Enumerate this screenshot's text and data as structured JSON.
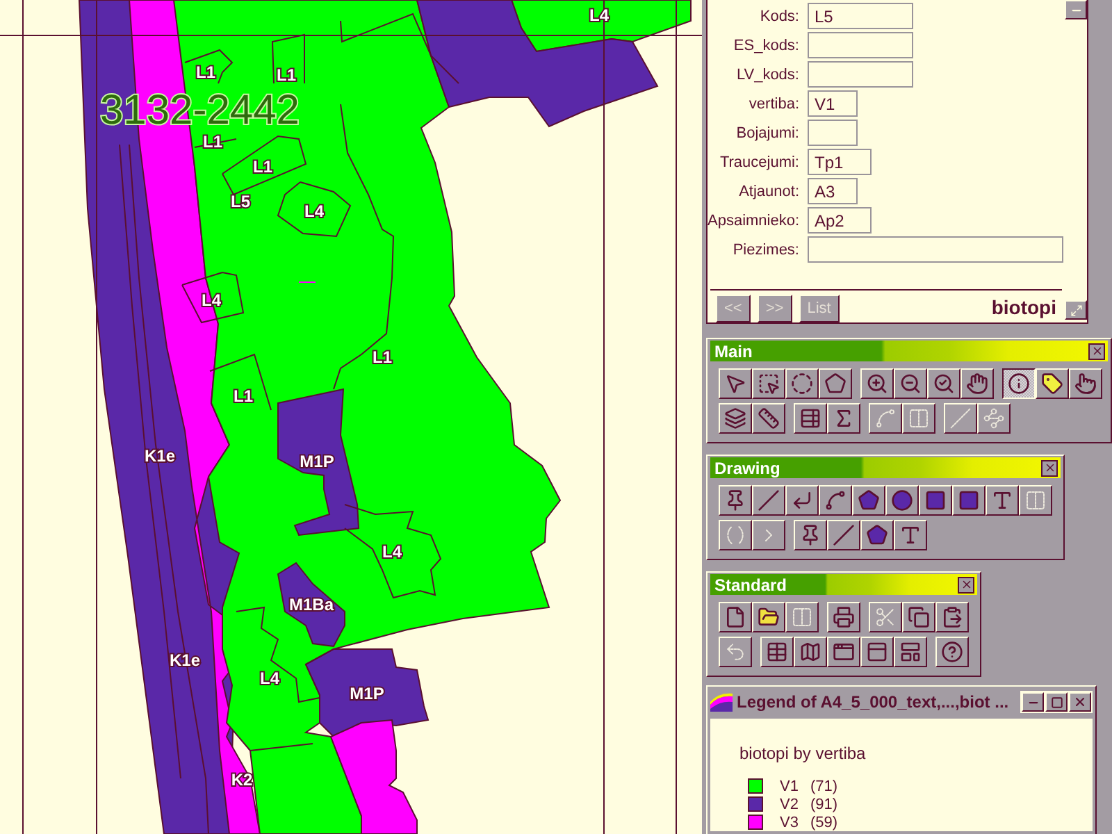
{
  "map": {
    "sheet_label": "3132-2442",
    "labels": [
      "L4",
      "L1",
      "L1",
      "L1",
      "L1",
      "L5",
      "L4",
      "L4",
      "L1",
      "L1",
      "K1e",
      "M1P",
      "L4",
      "M1Ba",
      "K1e",
      "L4",
      "M1P",
      "K2"
    ]
  },
  "attribute_window": {
    "title": "biotopi",
    "fields": [
      {
        "label": "Kods:",
        "value": "L5"
      },
      {
        "label": "ES_kods:"
      },
      {
        "label": "LV_kods:"
      },
      {
        "label": "vertiba:",
        "value": "V1"
      },
      {
        "label": "Bojajumi:"
      },
      {
        "label": "Traucejumi:",
        "value": "Tp1"
      },
      {
        "label": "Atjaunot:",
        "value": "A3"
      },
      {
        "label": "Apsaimnieko:",
        "value": "Ap2"
      },
      {
        "label": "Piezimes:"
      }
    ],
    "nav_buttons": [
      {
        "label": "<<",
        "disabled": true
      },
      {
        "label": ">>",
        "disabled": true
      },
      {
        "label": "List",
        "disabled": true
      }
    ]
  },
  "toolbars": [
    {
      "title": "Main",
      "rows": [
        [
          {
            "disabled": false,
            "selected": false
          },
          {
            "disabled": false,
            "selected": false
          },
          {
            "disabled": false,
            "selected": false
          },
          {
            "disabled": false,
            "selected": false
          },
          {
            "disabled": false,
            "selected": false
          },
          {
            "disabled": false,
            "selected": false
          },
          {
            "disabled": false,
            "selected": false
          },
          {
            "disabled": false,
            "selected": false
          },
          {
            "disabled": false,
            "selected": true
          },
          {
            "disabled": false,
            "selected": false
          },
          {
            "disabled": false,
            "selected": false
          }
        ],
        [
          {
            "disabled": false,
            "selected": false
          },
          {
            "disabled": false,
            "selected": false
          },
          {
            "disabled": false,
            "selected": false
          },
          {
            "disabled": false,
            "selected": false
          },
          {
            "disabled": true,
            "selected": false
          },
          {
            "disabled": true,
            "selected": false
          },
          {
            "disabled": true,
            "selected": false
          },
          {
            "disabled": true,
            "selected": false
          }
        ]
      ]
    },
    {
      "title": "Drawing",
      "rows": [
        [
          {
            "disabled": false
          },
          {
            "disabled": false
          },
          {
            "disabled": false
          },
          {
            "disabled": false
          },
          {
            "disabled": false
          },
          {
            "disabled": false
          },
          {
            "disabled": false
          },
          {
            "disabled": false
          },
          {
            "disabled": false
          },
          {
            "disabled": true
          }
        ],
        [
          {
            "disabled": true
          },
          {
            "disabled": true
          },
          {
            "disabled": false
          },
          {
            "disabled": false
          },
          {
            "disabled": false
          },
          {
            "disabled": false
          }
        ]
      ]
    },
    {
      "title": "Standard",
      "rows": [
        [
          {
            "disabled": false
          },
          {
            "disabled": false
          },
          {
            "disabled": true
          },
          {
            "disabled": false
          },
          {
            "disabled": true
          },
          {
            "disabled": false
          },
          {
            "disabled": false
          }
        ],
        [
          {
            "disabled": true
          },
          {
            "disabled": false
          },
          {
            "disabled": false
          },
          {
            "disabled": false
          },
          {
            "disabled": false
          },
          {
            "disabled": false
          },
          {
            "disabled": false
          }
        ]
      ]
    }
  ],
  "legend_window": {
    "title": "Legend of A4_5_000_text,...,biot ...",
    "heading": "biotopi by vertiba",
    "items": [
      {
        "label": "V1",
        "count": "(71)",
        "color": "#00ff00"
      },
      {
        "label": "V2",
        "count": "(91)",
        "color": "#5a28a8"
      },
      {
        "label": "V3",
        "count": "(59)",
        "color": "#ff00ff"
      }
    ]
  }
}
